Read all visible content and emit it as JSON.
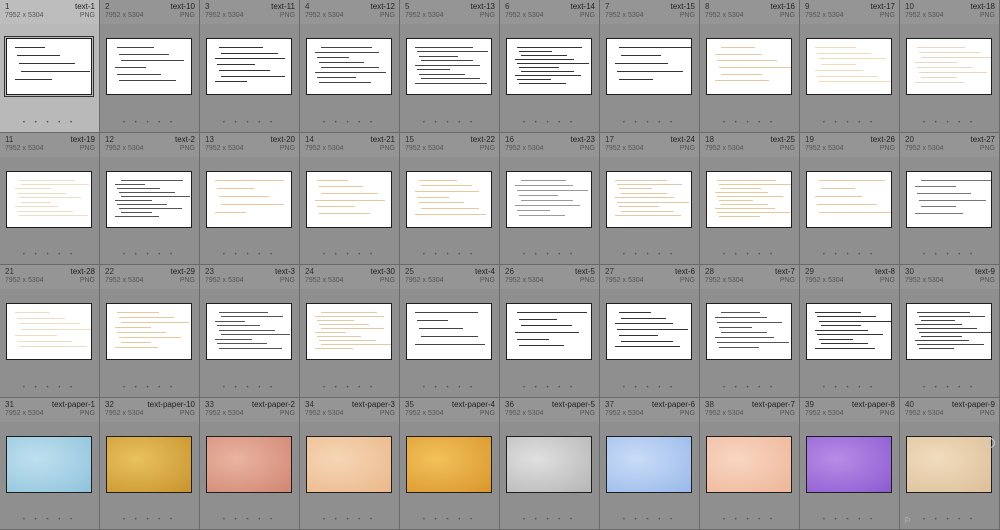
{
  "items": [
    {
      "index": "1",
      "name": "text-1",
      "dims": "7952 x 5304",
      "type": "PNG",
      "kind": "text",
      "paper": "#ffffff",
      "ink": "#333333",
      "selected": true
    },
    {
      "index": "2",
      "name": "text-10",
      "dims": "7952 x 5304",
      "type": "PNG",
      "kind": "text",
      "paper": "#ffffff",
      "ink": "#444444"
    },
    {
      "index": "3",
      "name": "text-11",
      "dims": "7952 x 5304",
      "type": "PNG",
      "kind": "text",
      "paper": "#ffffff",
      "ink": "#333333"
    },
    {
      "index": "4",
      "name": "text-12",
      "dims": "7952 x 5304",
      "type": "PNG",
      "kind": "text",
      "paper": "#ffffff",
      "ink": "#444444"
    },
    {
      "index": "5",
      "name": "text-13",
      "dims": "7952 x 5304",
      "type": "PNG",
      "kind": "text",
      "paper": "#ffffff",
      "ink": "#444444"
    },
    {
      "index": "6",
      "name": "text-14",
      "dims": "7952 x 5304",
      "type": "PNG",
      "kind": "text",
      "paper": "#ffffff",
      "ink": "#333333"
    },
    {
      "index": "7",
      "name": "text-15",
      "dims": "7952 x 5304",
      "type": "PNG",
      "kind": "text",
      "paper": "#ffffff",
      "ink": "#333333"
    },
    {
      "index": "8",
      "name": "text-16",
      "dims": "7952 x 5304",
      "type": "PNG",
      "kind": "text",
      "paper": "#ffffff",
      "ink": "#e3c9a3"
    },
    {
      "index": "9",
      "name": "text-17",
      "dims": "7952 x 5304",
      "type": "PNG",
      "kind": "text",
      "paper": "#ffffff",
      "ink": "#efdcb8"
    },
    {
      "index": "10",
      "name": "text-18",
      "dims": "7952 x 5304",
      "type": "PNG",
      "kind": "text",
      "paper": "#ffffff",
      "ink": "#e6d7c2"
    },
    {
      "index": "11",
      "name": "text-19",
      "dims": "7952 x 5304",
      "type": "PNG",
      "kind": "text",
      "paper": "#ffffff",
      "ink": "#efdcc4"
    },
    {
      "index": "12",
      "name": "text-2",
      "dims": "7952 x 5304",
      "type": "PNG",
      "kind": "text",
      "paper": "#ffffff",
      "ink": "#555555"
    },
    {
      "index": "13",
      "name": "text-20",
      "dims": "7952 x 5304",
      "type": "PNG",
      "kind": "text",
      "paper": "#ffffff",
      "ink": "#e6c89a"
    },
    {
      "index": "14",
      "name": "text-21",
      "dims": "7952 x 5304",
      "type": "PNG",
      "kind": "text",
      "paper": "#ffffff",
      "ink": "#e6c89a"
    },
    {
      "index": "15",
      "name": "text-22",
      "dims": "7952 x 5304",
      "type": "PNG",
      "kind": "text",
      "paper": "#ffffff",
      "ink": "#e6c89a"
    },
    {
      "index": "16",
      "name": "text-23",
      "dims": "7952 x 5304",
      "type": "PNG",
      "kind": "text",
      "paper": "#ffffff",
      "ink": "#999999"
    },
    {
      "index": "17",
      "name": "text-24",
      "dims": "7952 x 5304",
      "type": "PNG",
      "kind": "text",
      "paper": "#ffffff",
      "ink": "#e3c9a3"
    },
    {
      "index": "18",
      "name": "text-25",
      "dims": "7952 x 5304",
      "type": "PNG",
      "kind": "text",
      "paper": "#ffffff",
      "ink": "#e6c89a"
    },
    {
      "index": "19",
      "name": "text-26",
      "dims": "7952 x 5304",
      "type": "PNG",
      "kind": "text",
      "paper": "#ffffff",
      "ink": "#e3c9a3"
    },
    {
      "index": "20",
      "name": "text-27",
      "dims": "7952 x 5304",
      "type": "PNG",
      "kind": "text",
      "paper": "#ffffff",
      "ink": "#777777"
    },
    {
      "index": "21",
      "name": "text-28",
      "dims": "7952 x 5304",
      "type": "PNG",
      "kind": "text",
      "paper": "#ffffff",
      "ink": "#efdcc4"
    },
    {
      "index": "22",
      "name": "text-29",
      "dims": "7952 x 5304",
      "type": "PNG",
      "kind": "text",
      "paper": "#ffffff",
      "ink": "#e6c89a"
    },
    {
      "index": "23",
      "name": "text-3",
      "dims": "7952 x 5304",
      "type": "PNG",
      "kind": "text",
      "paper": "#ffffff",
      "ink": "#555555"
    },
    {
      "index": "24",
      "name": "text-30",
      "dims": "7952 x 5304",
      "type": "PNG",
      "kind": "text",
      "paper": "#ffffff",
      "ink": "#e3c9a3"
    },
    {
      "index": "25",
      "name": "text-4",
      "dims": "7952 x 5304",
      "type": "PNG",
      "kind": "text",
      "paper": "#ffffff",
      "ink": "#444444"
    },
    {
      "index": "26",
      "name": "text-5",
      "dims": "7952 x 5304",
      "type": "PNG",
      "kind": "text",
      "paper": "#ffffff",
      "ink": "#333333"
    },
    {
      "index": "27",
      "name": "text-6",
      "dims": "7952 x 5304",
      "type": "PNG",
      "kind": "text",
      "paper": "#ffffff",
      "ink": "#333333"
    },
    {
      "index": "28",
      "name": "text-7",
      "dims": "7952 x 5304",
      "type": "PNG",
      "kind": "text",
      "paper": "#ffffff",
      "ink": "#555555"
    },
    {
      "index": "29",
      "name": "text-8",
      "dims": "7952 x 5304",
      "type": "PNG",
      "kind": "text",
      "paper": "#ffffff",
      "ink": "#333333"
    },
    {
      "index": "30",
      "name": "text-9",
      "dims": "7952 x 5304",
      "type": "PNG",
      "kind": "text",
      "paper": "#ffffff",
      "ink": "#444444"
    },
    {
      "index": "31",
      "name": "text-paper-1",
      "dims": "7952 x 5304",
      "type": "PNG",
      "kind": "paper",
      "paper": "#bfe0ee",
      "paper2": "#8fc3dc"
    },
    {
      "index": "32",
      "name": "text-paper-10",
      "dims": "7952 x 5304",
      "type": "PNG",
      "kind": "paper",
      "paper": "#e8c25d",
      "paper2": "#c9932e"
    },
    {
      "index": "33",
      "name": "text-paper-2",
      "dims": "7952 x 5304",
      "type": "PNG",
      "kind": "paper",
      "paper": "#eab4a2",
      "paper2": "#d08672"
    },
    {
      "index": "34",
      "name": "text-paper-3",
      "dims": "7952 x 5304",
      "type": "PNG",
      "kind": "paper",
      "paper": "#f6d6b6",
      "paper2": "#eab889"
    },
    {
      "index": "35",
      "name": "text-paper-4",
      "dims": "7952 x 5304",
      "type": "PNG",
      "kind": "paper",
      "paper": "#f3c15a",
      "paper2": "#d9962c"
    },
    {
      "index": "36",
      "name": "text-paper-5",
      "dims": "7952 x 5304",
      "type": "PNG",
      "kind": "paper",
      "paper": "#e0e0e0",
      "paper2": "#b5b5b5"
    },
    {
      "index": "37",
      "name": "text-paper-6",
      "dims": "7952 x 5304",
      "type": "PNG",
      "kind": "paper",
      "paper": "#cadcf7",
      "paper2": "#98b9ea"
    },
    {
      "index": "38",
      "name": "text-paper-7",
      "dims": "7952 x 5304",
      "type": "PNG",
      "kind": "paper",
      "paper": "#f9d6c2",
      "paper2": "#eeb599"
    },
    {
      "index": "39",
      "name": "text-paper-8",
      "dims": "7952 x 5304",
      "type": "PNG",
      "kind": "paper",
      "paper": "#b88ce6",
      "paper2": "#8c5bd1"
    },
    {
      "index": "40",
      "name": "text-paper-9",
      "dims": "7952 x 5304",
      "type": "PNG",
      "kind": "paper",
      "paper": "#f1dcbf",
      "paper2": "#dcbf98",
      "last": true
    }
  ],
  "ui": {
    "dots": "• • • • •",
    "flag": "⚐"
  }
}
